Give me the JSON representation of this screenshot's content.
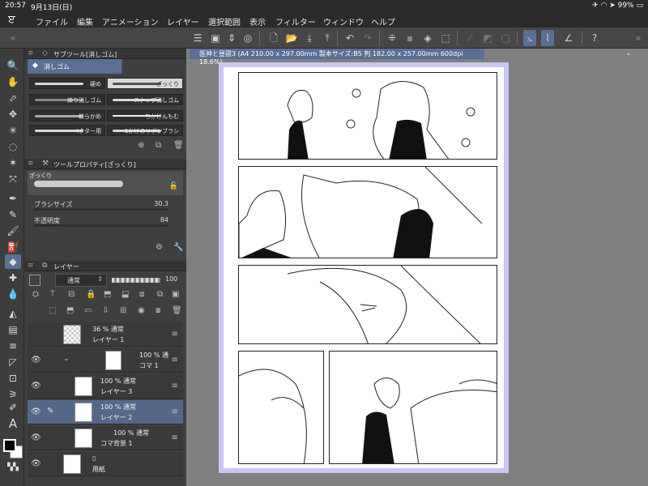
{
  "status": {
    "time": "20:57",
    "date": "9月13日(日)",
    "battery": "99%"
  },
  "menu": [
    "ファイル",
    "編集",
    "アニメーション",
    "レイヤー",
    "選択範囲",
    "表示",
    "フィルター",
    "ウィンドウ",
    "ヘルプ"
  ],
  "subtool": {
    "title": "サブツール[消しゴム]",
    "group": "消しゴム",
    "items": [
      {
        "label": "硬め",
        "selected": false
      },
      {
        "label": "ざっくり",
        "selected": true
      },
      {
        "label": "練り消しゴム",
        "selected": false
      },
      {
        "label": "スナップ消しゴム",
        "selected": false
      },
      {
        "label": "軟らかめ",
        "selected": false
      },
      {
        "label": "ちかけんもむ",
        "selected": false
      },
      {
        "label": "ベクター用",
        "selected": false
      },
      {
        "label": "1かけのリボンブラシ",
        "selected": false
      }
    ]
  },
  "toolprop": {
    "title": "ツールプロパティ[ざっくり]",
    "preset": "ざっくり",
    "brush_size_label": "ブラシサイズ",
    "brush_size": "30.3",
    "opacity_label": "不透明度",
    "opacity": "84"
  },
  "layers": {
    "title": "レイヤー",
    "blend": "通常",
    "opacity": "100",
    "rows": [
      {
        "pct": "36 % 通常",
        "name": "レイヤー 1",
        "visible": false,
        "selected": false
      },
      {
        "pct": "100 % 通",
        "name": "コマ 1",
        "visible": true,
        "selected": false
      },
      {
        "pct": "100 % 通常",
        "name": "レイヤー 3",
        "visible": true,
        "selected": false
      },
      {
        "pct": "100 % 通常",
        "name": "レイヤー 2",
        "visible": true,
        "selected": true
      },
      {
        "pct": "100 % 通常",
        "name": "コマ背景 1",
        "visible": true,
        "selected": false
      },
      {
        "pct": "",
        "name": "用紙",
        "visible": true,
        "selected": false
      }
    ]
  },
  "document": {
    "tab": "医神と昼寝3 (A4 210.00 x 297.00mm 製本サイズ:B5 判 182.00 x 257.00mm 600dpi 18.6%)"
  },
  "colors": {
    "main": "#000000",
    "sub": "#ffffff",
    "accent": "#5a6e96",
    "page_bg": "#c8c8f2"
  }
}
